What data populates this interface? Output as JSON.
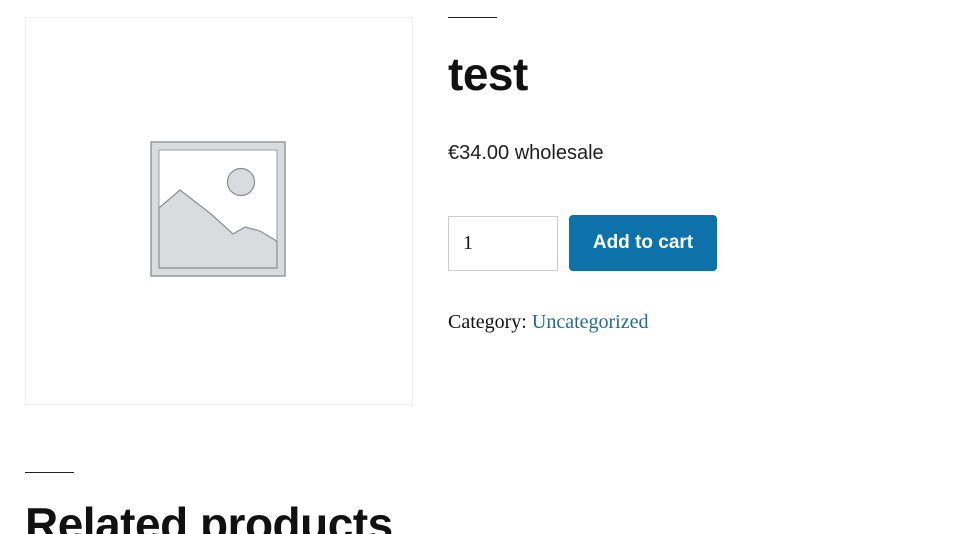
{
  "product": {
    "title": "test",
    "price": "€34.00 wholesale",
    "quantity": "1",
    "add_to_cart_label": "Add to cart",
    "category_label": "Category:",
    "category_link": "Uncategorized",
    "image": {
      "icon": "image-placeholder-icon"
    }
  },
  "related": {
    "title": "Related products"
  },
  "colors": {
    "button": "#0c72a9",
    "link": "#1f6f8b",
    "placeholder": "#d8d9dc"
  }
}
